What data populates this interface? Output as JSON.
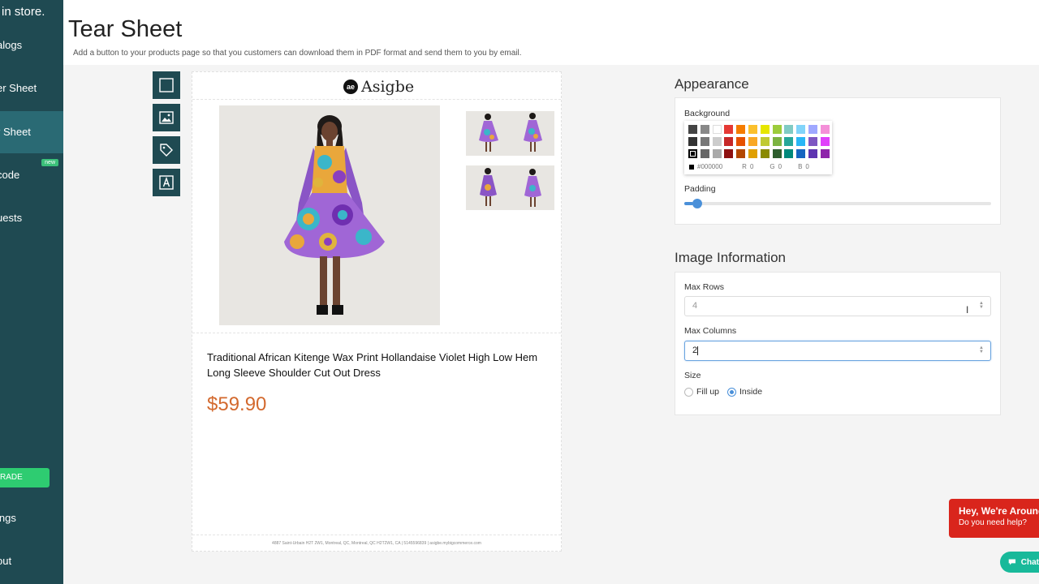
{
  "sidebar": {
    "brand": "in store.",
    "items": [
      {
        "label": "alogs"
      },
      {
        "label": "er Sheet"
      },
      {
        "label": "r Sheet"
      },
      {
        "label": "code"
      },
      {
        "label": "uests"
      }
    ],
    "new_badge": "new",
    "upgrade_label": "RADE",
    "bottom_items": [
      {
        "label": "ings"
      },
      {
        "label": "out"
      }
    ]
  },
  "header": {
    "title": "Tear Sheet",
    "description": "Add a button to your products page so that you customers can download them in PDF format and send them to you by email."
  },
  "preview": {
    "logo_badge": "ae",
    "logo_text": "Asigbe",
    "product_title": "Traditional African Kitenge Wax Print Hollandaise Violet High Low Hem Long Sleeve Shoulder Cut Out Dress",
    "price": "$59.90",
    "footer_address": "4887 Saint-Urbain H2T 2W1, Montreal, QC, Montreal, QC H2T2W1, CA | 5145596839 | asigbe.mybigcommerce.com"
  },
  "appearance": {
    "title": "Appearance",
    "background_label": "Background",
    "hex_value": "#000000",
    "r_label": "R",
    "r_value": "0",
    "g_label": "G",
    "g_value": "0",
    "b_label": "B",
    "b_value": "0",
    "padding_label": "Padding",
    "padding_value_fraction": 0.03,
    "colors": {
      "accent": "#4a90d9",
      "sidebar": "#1f4a52",
      "price": "#d3692e"
    }
  },
  "image_info": {
    "title": "Image Information",
    "max_rows_label": "Max Rows",
    "max_rows_value": "4",
    "max_columns_label": "Max Columns",
    "max_columns_value": "2",
    "size_label": "Size",
    "size_option_fill": "Fill up",
    "size_option_inside": "Inside",
    "size_selected": "Inside"
  },
  "chat": {
    "heading": "Hey, We're Around",
    "subtext": "Do you need help?",
    "button_label": "Chat"
  }
}
